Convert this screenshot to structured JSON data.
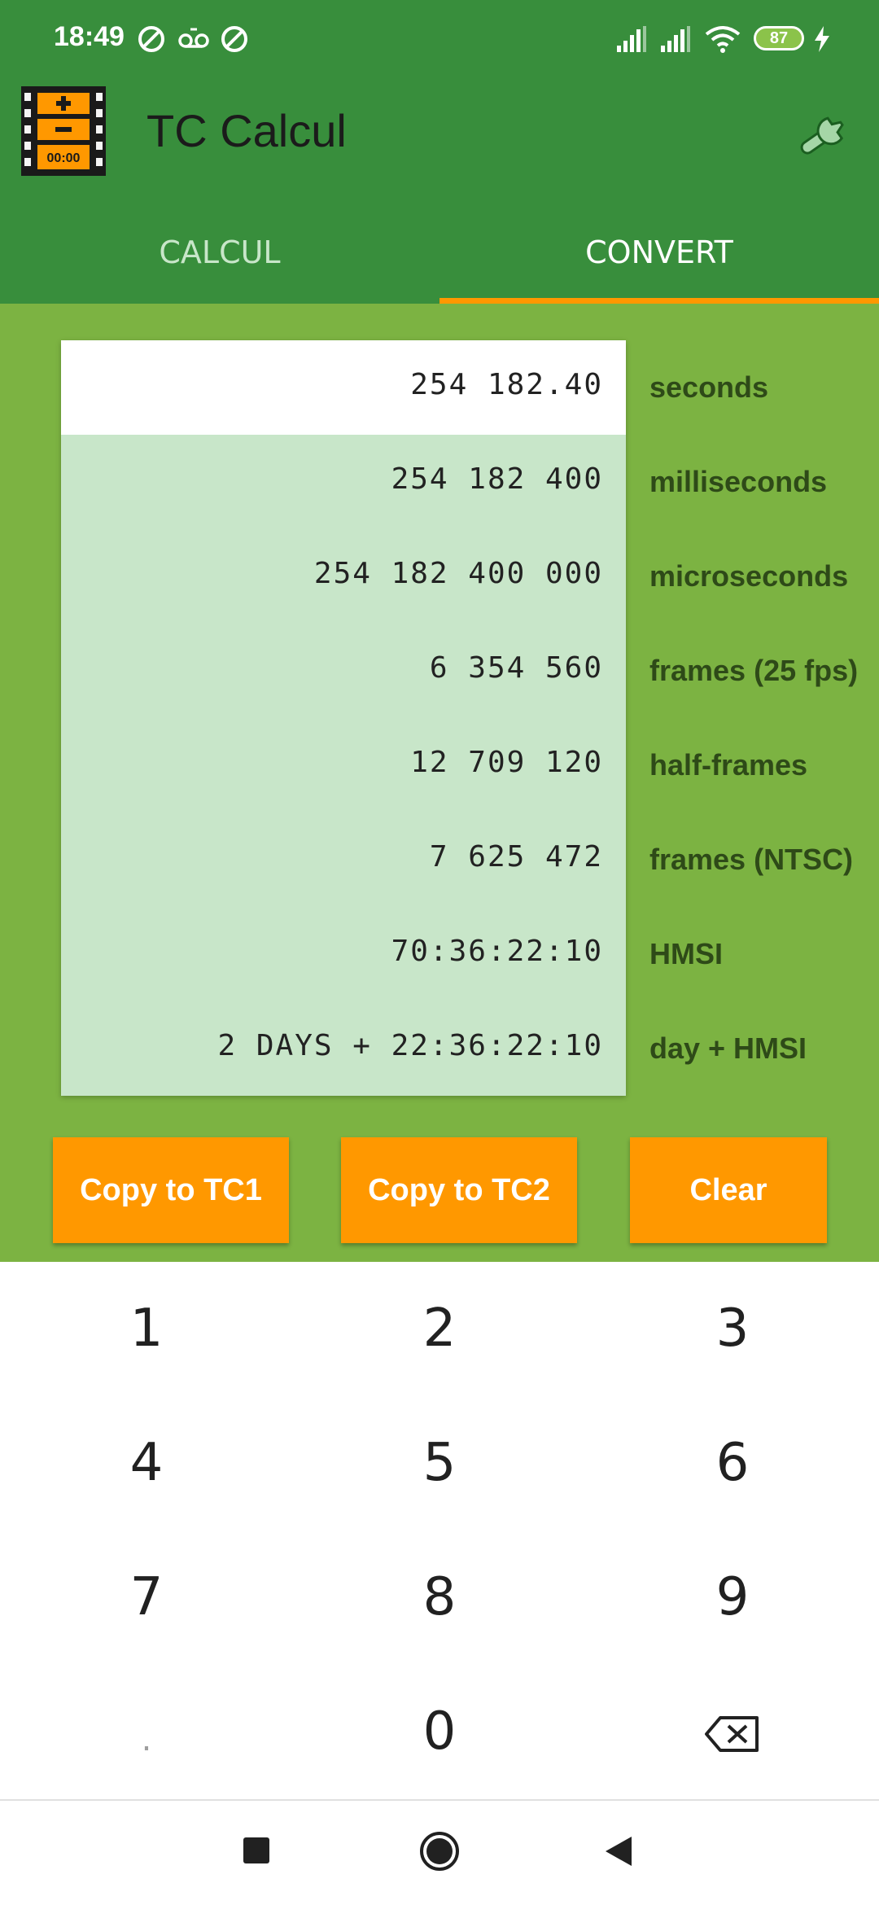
{
  "status_bar": {
    "time": "18:49",
    "battery": "87",
    "icons": [
      "no-disturb-icon",
      "voicemail-icon",
      "no-disturb-icon",
      "signal-icon",
      "signal-icon",
      "wifi-icon",
      "battery-icon",
      "charging-icon"
    ]
  },
  "app": {
    "title": "TC Calcul",
    "logo_text": "00:00",
    "settings_icon": "wrench-icon"
  },
  "tabs": [
    {
      "label": "CALCUL",
      "selected": false
    },
    {
      "label": "CONVERT",
      "selected": true
    }
  ],
  "conversions": [
    {
      "value": "254 182.40",
      "unit": "seconds"
    },
    {
      "value": "254 182 400",
      "unit": "milliseconds"
    },
    {
      "value": "254 182 400 000",
      "unit": "microseconds"
    },
    {
      "value": "6 354 560",
      "unit": "frames (25 fps)"
    },
    {
      "value": "12 709 120",
      "unit": "half-frames"
    },
    {
      "value": "7 625 472",
      "unit": "frames (NTSC)"
    },
    {
      "value": "70:36:22:10",
      "unit": "HMSI"
    },
    {
      "value": "2 DAYS + 22:36:22:10",
      "unit": "day + HMSI"
    }
  ],
  "actions": {
    "copy_tc1": "Copy to TC1",
    "copy_tc2": "Copy to TC2",
    "clear": "Clear"
  },
  "keypad": {
    "keys": [
      "1",
      "2",
      "3",
      "4",
      "5",
      "6",
      "7",
      "8",
      "9",
      ".",
      "0"
    ],
    "backspace_icon": "backspace-icon"
  },
  "nav_bar": {
    "icons": [
      "recents-icon",
      "home-icon",
      "back-icon"
    ]
  },
  "colors": {
    "app_bar": "#388e3c",
    "content_bg": "#7cb342",
    "accent": "#ff9800",
    "panel": "#c8e6c9"
  }
}
